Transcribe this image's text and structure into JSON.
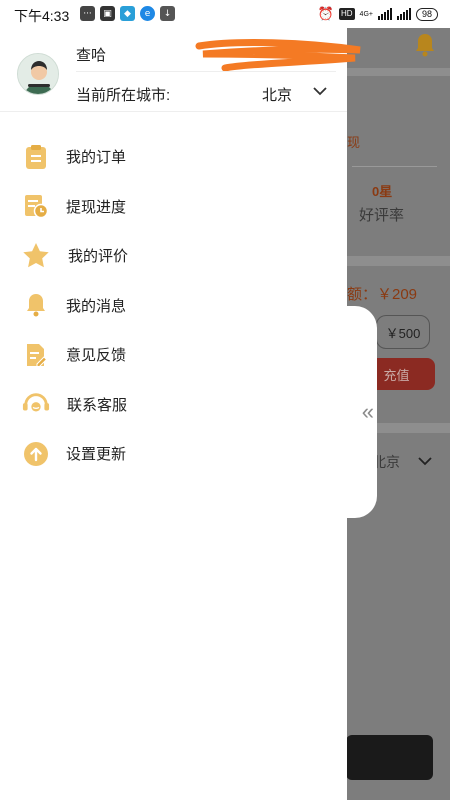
{
  "status_bar": {
    "time": "下午4:33",
    "network": "4G+",
    "battery": "98",
    "hd_badge": "HD"
  },
  "drawer": {
    "username": "查哈",
    "city_label": "当前所在城市:",
    "city_value": "北京",
    "menu": [
      {
        "label": "我的订单",
        "icon": "clipboard-icon"
      },
      {
        "label": "提现进度",
        "icon": "withdraw-progress-icon"
      },
      {
        "label": "我的评价",
        "icon": "star-icon"
      },
      {
        "label": "我的消息",
        "icon": "bell-icon"
      },
      {
        "label": "意见反馈",
        "icon": "feedback-edit-icon"
      },
      {
        "label": "联系客服",
        "icon": "headset-icon"
      },
      {
        "label": "设置更新",
        "icon": "upload-arrow-icon"
      }
    ]
  },
  "background": {
    "withdraw_fragment": "现",
    "rating_stars": "0星",
    "rating_label": "好评率",
    "balance_fragment": "额：￥209",
    "amount_option": "￥500",
    "recharge_button": "充值",
    "city_fragment": "北京"
  },
  "collapse_tab": {
    "glyph": "«"
  },
  "colors": {
    "accent": "#f0c36a",
    "drawer_bg": "#ffffff",
    "overlay": "#7d7d7d",
    "recharge_red": "#e0463a"
  }
}
